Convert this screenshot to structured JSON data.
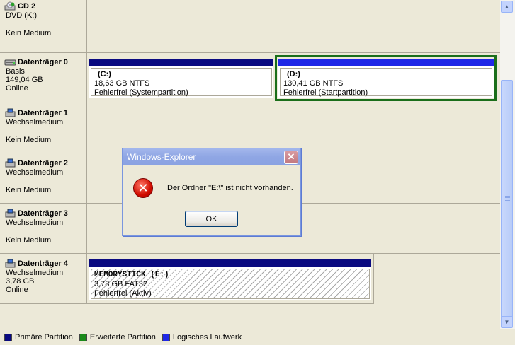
{
  "disks": [
    {
      "title": "CD 2",
      "lines": [
        "DVD (K:)",
        "",
        "Kein Medium"
      ],
      "icon": "cd-drive-icon"
    },
    {
      "title": "Datenträger 0",
      "lines": [
        "Basis",
        "149,04 GB",
        "Online"
      ],
      "icon": "hard-disk-icon",
      "partitions": [
        {
          "label": "(C:)",
          "size": "18,63 GB NTFS",
          "status": "Fehlerfrei (Systempartition)"
        },
        {
          "label": "(D:)",
          "size": "130,41 GB NTFS",
          "status": "Fehlerfrei (Startpartition)"
        }
      ]
    },
    {
      "title": "Datenträger 1",
      "lines": [
        "Wechselmedium",
        "",
        "Kein Medium"
      ],
      "icon": "removable-disk-icon"
    },
    {
      "title": "Datenträger 2",
      "lines": [
        "Wechselmedium",
        "",
        "Kein Medium"
      ],
      "icon": "removable-disk-icon"
    },
    {
      "title": "Datenträger 3",
      "lines": [
        "Wechselmedium",
        "",
        "Kein Medium"
      ],
      "icon": "removable-disk-icon"
    },
    {
      "title": "Datenträger 4",
      "lines": [
        "Wechselmedium",
        "3,78 GB",
        "Online"
      ],
      "icon": "removable-disk-icon",
      "partitions": [
        {
          "label": "MEMORYSTICK  (E:)",
          "size": "3,78 GB FAT32",
          "status": "Fehlerfrei (Aktiv)"
        }
      ]
    }
  ],
  "legend": [
    {
      "label": "Primäre Partition",
      "color": "#0a0a80"
    },
    {
      "label": "Erweiterte Partition",
      "color": "#1a8a1a"
    },
    {
      "label": "Logisches Laufwerk",
      "color": "#1f28e6"
    }
  ],
  "dialog": {
    "title": "Windows-Explorer",
    "close": "✕",
    "icon": "error-icon",
    "message": "Der Ordner \"E:\\\" ist nicht vorhanden.",
    "ok_label": "OK"
  },
  "scrollbar": {
    "up": "▲",
    "down": "▼"
  }
}
